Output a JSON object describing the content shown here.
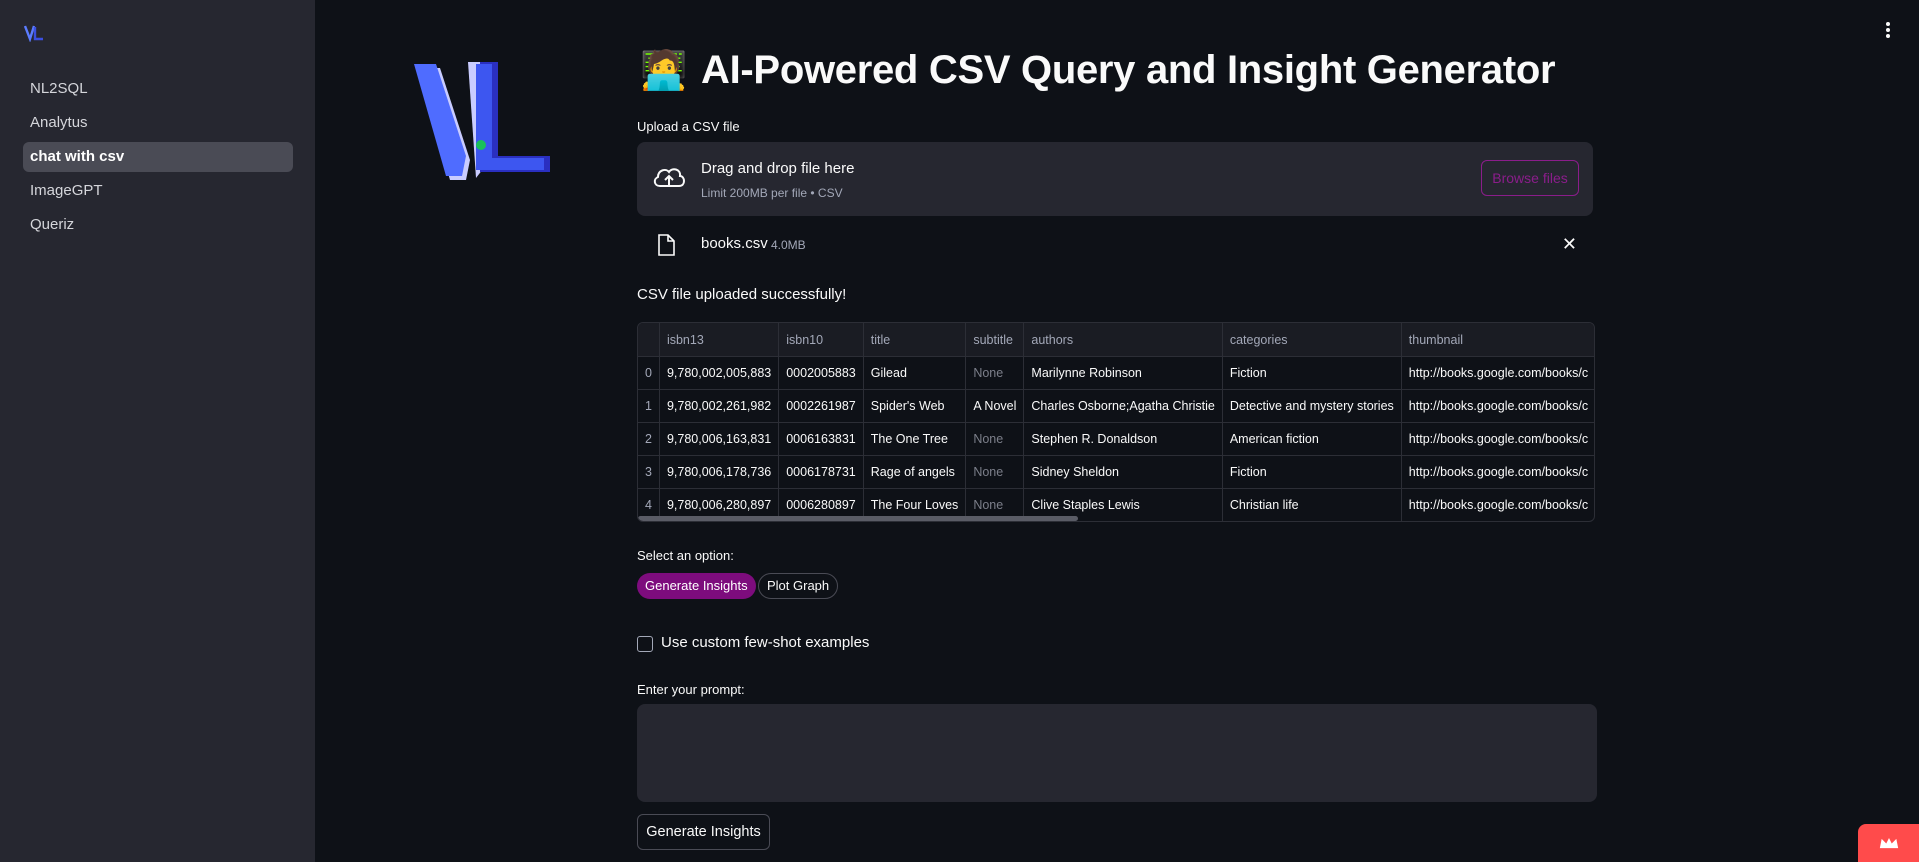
{
  "sidebar": {
    "items": [
      {
        "label": "NL2SQL"
      },
      {
        "label": "Analytus"
      },
      {
        "label": "chat with csv"
      },
      {
        "label": "ImageGPT"
      },
      {
        "label": "Queriz"
      }
    ]
  },
  "header": {
    "title": "AI-Powered CSV Query and Insight Generator",
    "title_emoji": "🧑‍💻"
  },
  "upload": {
    "label": "Upload a CSV file",
    "drop_text": "Drag and drop file here",
    "limit_text": "Limit 200MB per file • CSV",
    "browse_label": "Browse files"
  },
  "file": {
    "name": "books.csv",
    "size": "4.0MB"
  },
  "success_message": "CSV file uploaded successfully!",
  "table": {
    "columns": [
      "isbn13",
      "isbn10",
      "title",
      "subtitle",
      "authors",
      "categories",
      "thumbnail"
    ],
    "rows": [
      {
        "index": "0",
        "isbn13": "9,780,002,005,883",
        "isbn10": "0002005883",
        "title": "Gilead",
        "subtitle": "None",
        "authors": "Marilynne Robinson",
        "categories": "Fiction",
        "thumbnail": "http://books.google.com/books/c"
      },
      {
        "index": "1",
        "isbn13": "9,780,002,261,982",
        "isbn10": "0002261987",
        "title": "Spider's Web",
        "subtitle": "A Novel",
        "authors": "Charles Osborne;Agatha Christie",
        "categories": "Detective and mystery stories",
        "thumbnail": "http://books.google.com/books/c"
      },
      {
        "index": "2",
        "isbn13": "9,780,006,163,831",
        "isbn10": "0006163831",
        "title": "The One Tree",
        "subtitle": "None",
        "authors": "Stephen R. Donaldson",
        "categories": "American fiction",
        "thumbnail": "http://books.google.com/books/c"
      },
      {
        "index": "3",
        "isbn13": "9,780,006,178,736",
        "isbn10": "0006178731",
        "title": "Rage of angels",
        "subtitle": "None",
        "authors": "Sidney Sheldon",
        "categories": "Fiction",
        "thumbnail": "http://books.google.com/books/c"
      },
      {
        "index": "4",
        "isbn13": "9,780,006,280,897",
        "isbn10": "0006280897",
        "title": "The Four Loves",
        "subtitle": "None",
        "authors": "Clive Staples Lewis",
        "categories": "Christian life",
        "thumbnail": "http://books.google.com/books/c"
      }
    ]
  },
  "options": {
    "label": "Select an option:",
    "choices": [
      "Generate Insights",
      "Plot Graph"
    ],
    "selected": "Generate Insights"
  },
  "few_shot": {
    "label": "Use custom few-shot examples",
    "checked": false
  },
  "prompt": {
    "label": "Enter your prompt:",
    "value": ""
  },
  "submit_label": "Generate Insights",
  "colors": {
    "accent": "#7d0c7d",
    "background": "#0e1117",
    "sidebar": "#262730",
    "badge": "#ff4b4b"
  }
}
